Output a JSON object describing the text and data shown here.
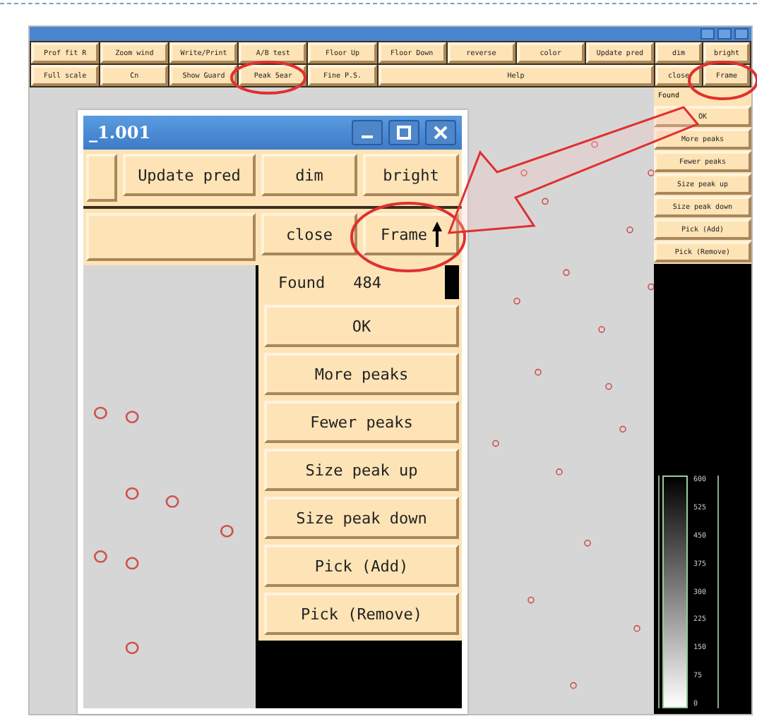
{
  "app": {
    "toolbar_row1": [
      "Prof fit R",
      "Zoom wind",
      "Write/Print",
      "A/B test",
      "Floor Up",
      "Floor Down",
      "reverse",
      "color",
      "Update pred",
      "dim",
      "bright"
    ],
    "toolbar_row2": [
      "Full scale",
      "Cn",
      "Show Guard",
      "Peak Sear",
      "Fine P.S.",
      "Help",
      "close",
      "Frame"
    ],
    "found_label": "Found",
    "side_buttons": [
      "OK",
      "More peaks",
      "Fewer peaks",
      "Size peak up",
      "Size peak down",
      "Pick (Add)",
      "Pick (Remove)"
    ],
    "colorbar_ticks": [
      "600",
      "525",
      "450",
      "375",
      "300",
      "225",
      "150",
      "75",
      "0"
    ]
  },
  "zoom_inset": {
    "title": "_1.001",
    "row1": [
      "Update pred",
      "dim",
      "bright"
    ],
    "row2": [
      "close",
      "Frame"
    ],
    "found_label": "Found",
    "found_value": "484",
    "side_buttons": [
      "OK",
      "More peaks",
      "Fewer peaks",
      "Size peak up",
      "Size peak down",
      "Pick (Add)",
      "Pick (Remove)"
    ]
  }
}
